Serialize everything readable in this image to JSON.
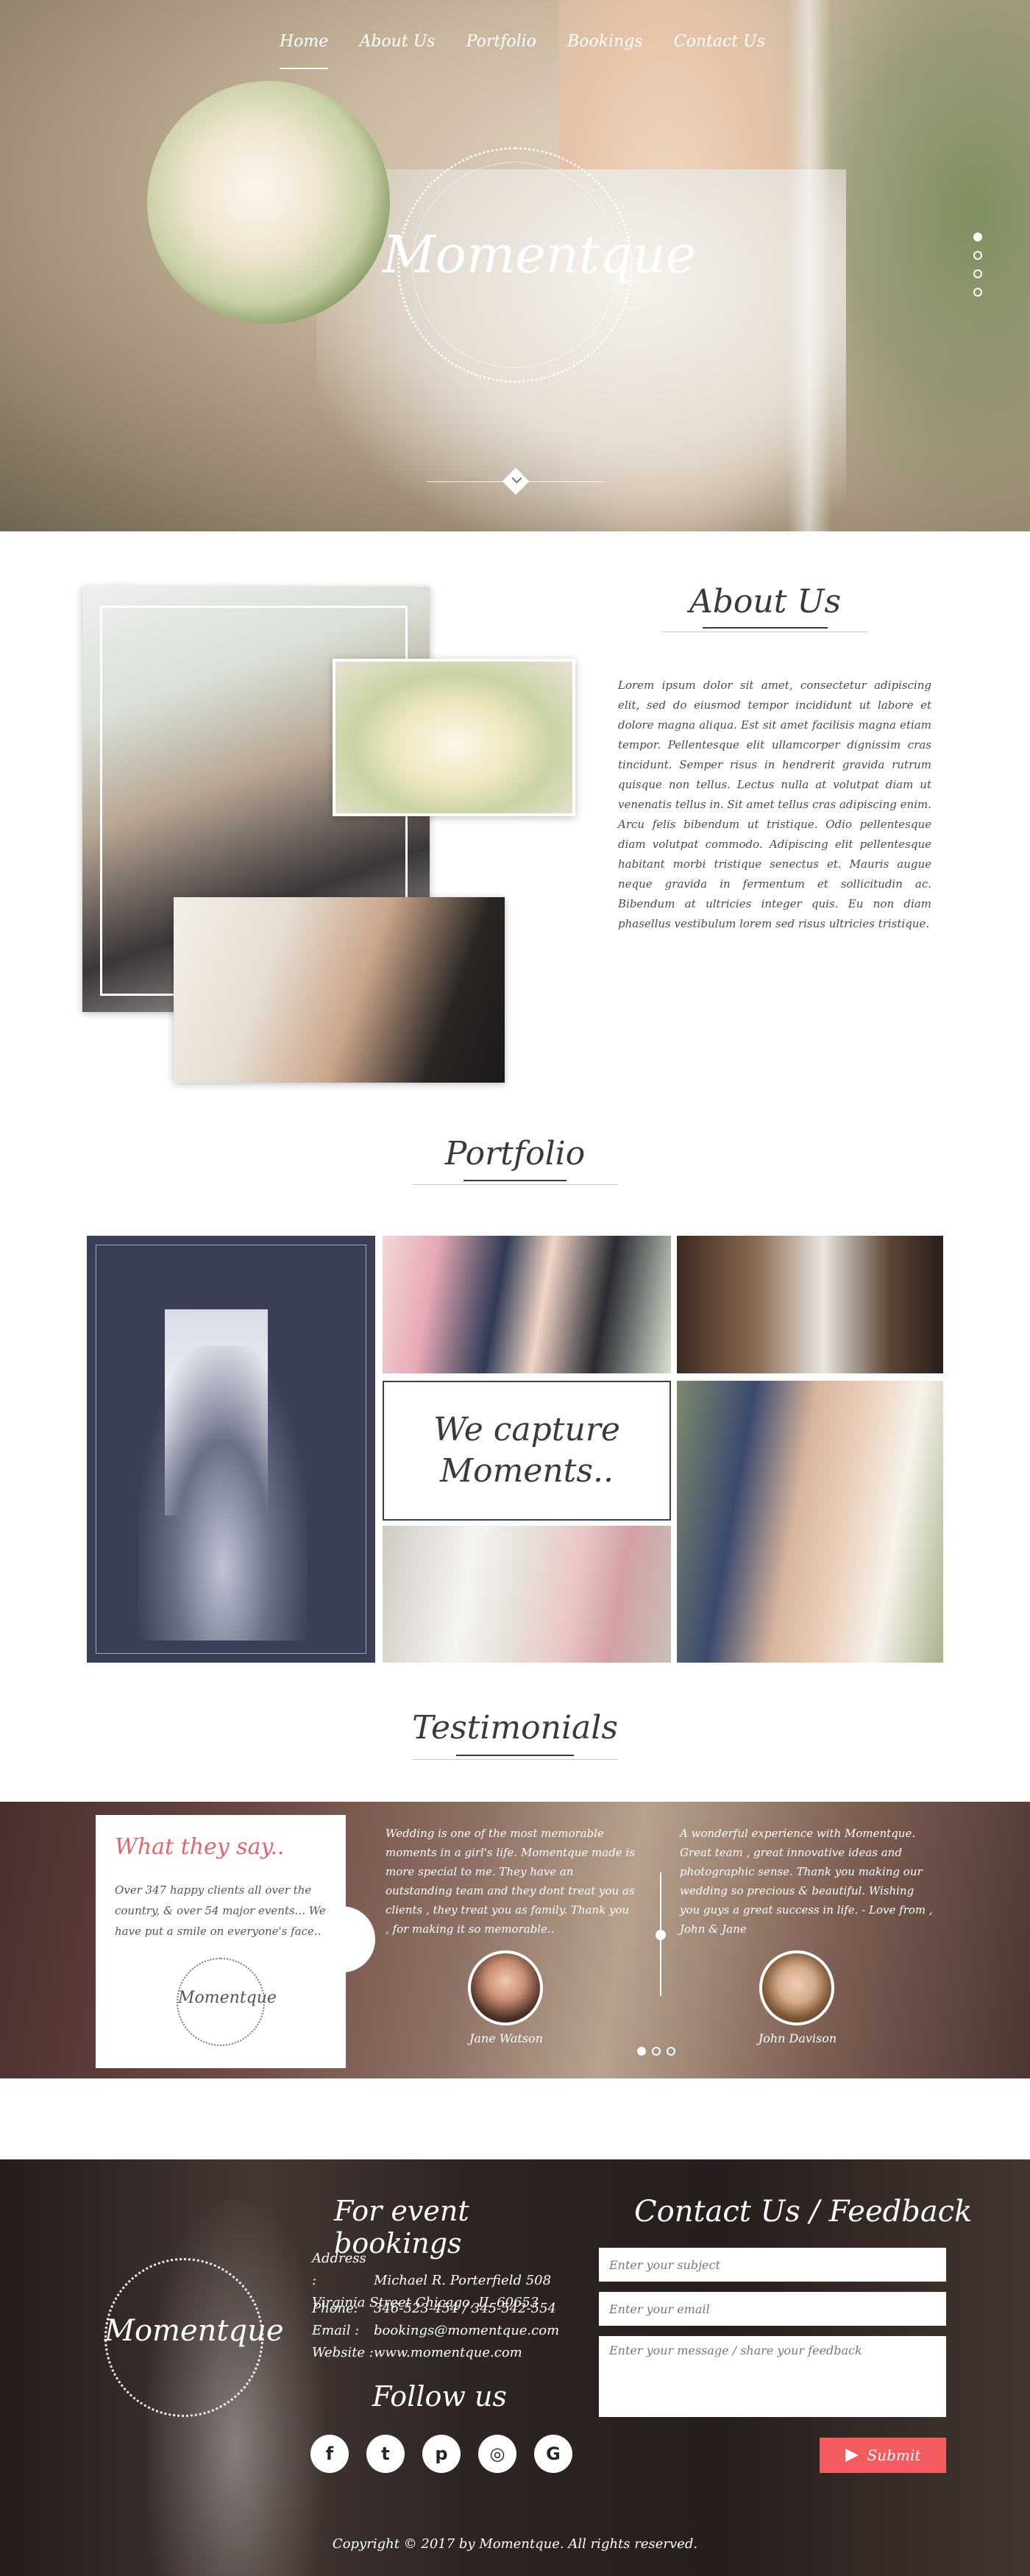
{
  "nav": {
    "items": [
      {
        "label": "Home"
      },
      {
        "label": "About Us"
      },
      {
        "label": "Portfolio"
      },
      {
        "label": "Bookings"
      },
      {
        "label": "Contact Us"
      }
    ]
  },
  "hero": {
    "logo_text": "Momentque",
    "slider_dots": 4,
    "active_dot": 1
  },
  "about": {
    "title": "About Us",
    "body": "Lorem ipsum dolor sit amet, consectetur adipiscing elit, sed do eiusmod tempor incididunt ut labore et dolore magna aliqua. Est sit amet facilisis magna etiam tempor. Pellentesque elit ullamcorper dignissim cras tincidunt. Semper risus in hendrerit gravida rutrum quisque non tellus. Lectus nulla at volutpat diam ut venenatis tellus in. Sit amet tellus cras adipiscing enim. Arcu felis bibendum ut tristique. Odio pellentesque diam volutpat commodo. Adipiscing elit pellentesque habitant morbi tristique senectus et. Mauris augue neque gravida in fermentum et sollicitudin ac. Bibendum at ultricies integer quis. Eu non diam phasellus vestibulum lorem sed risus ultricies tristique."
  },
  "portfolio": {
    "title": "Portfolio",
    "capture_line1": "We capture",
    "capture_line2": "Moments.."
  },
  "testimonials": {
    "title": "Testimonials",
    "card_heading": "What they say..",
    "card_body": "Over 347 happy clients all over the country, & over 54 major events... We have put a smile on everyone's face..",
    "card_logo_text": "Momentque",
    "quotes": [
      {
        "text": "Wedding is one of the most memorable moments in a girl's life. Momentque made is more special to me. They have an outstanding team and they dont treat you as clients , they treat you as family. Thank you , for making it so memorable..",
        "name": "Jane Watson"
      },
      {
        "text": "A wonderful experience with Momentque. Great team , great innovative ideas and photographic sense. Thank you making our wedding so precious & beautiful. Wishing you guys a great success in life. - Love from , John & Jane",
        "name": "John Davison"
      }
    ],
    "dots": 3,
    "active_dot": 1
  },
  "footer": {
    "logo_text": "Momentque",
    "booking_title": "For event bookings",
    "address_label": "Address :",
    "address_line1": "Michael R. Porterfield 508 Virginia Street Chicago, IL 60653",
    "phone_label": "Phone:",
    "phone_value": "346-523-454  /  345-542-554",
    "email_label": "Email :",
    "email_value": "bookings@momentque.com",
    "website_label": "Website :",
    "website_value": "www.momentque.com",
    "follow_title": "Follow us",
    "social": [
      {
        "icon": "facebook-icon",
        "glyph": "f"
      },
      {
        "icon": "twitter-icon",
        "glyph": "t"
      },
      {
        "icon": "pinterest-icon",
        "glyph": "p"
      },
      {
        "icon": "instagram-icon",
        "glyph": "◎"
      },
      {
        "icon": "google-icon",
        "glyph": "G"
      }
    ],
    "contact_title": "Contact Us / Feedback",
    "subject_placeholder": "Enter your subject",
    "email_placeholder": "Enter your email",
    "message_placeholder": "Enter your message / share your feedback",
    "submit_label": "Submit",
    "copyright": "Copyright © 2017 by Momentque. All rights reserved."
  },
  "colors": {
    "accent_red": "#f35b5e",
    "testimonial_heading": "#e5636b",
    "portfolio_navy": "#3a3f57"
  }
}
